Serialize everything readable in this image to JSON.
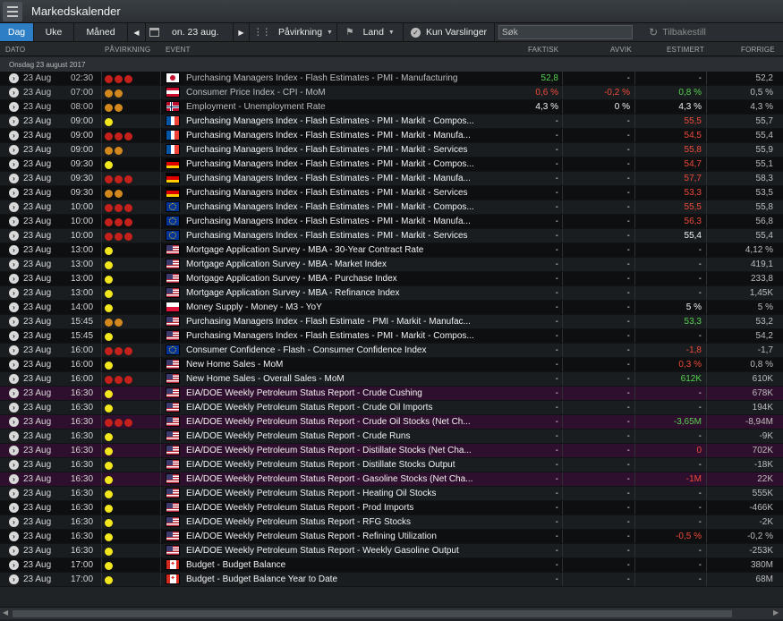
{
  "window": {
    "title": "Markedskalender"
  },
  "toolbar": {
    "day_label": "Dag",
    "week_label": "Uke",
    "month_label": "Måned",
    "date_label": "on. 23 aug.",
    "impact_label": "Påvirkning",
    "country_label": "Land",
    "alerts_label": "Kun Varslinger",
    "search_placeholder": "Søk",
    "reset_label": "Tilbakestill"
  },
  "columns": {
    "date": "DATO",
    "impact": "PÅVIRKNING",
    "event": "EVENT",
    "actual": "FAKTISK",
    "deviation": "AVVIK",
    "estimated": "ESTIMERT",
    "previous": "FORRIGE"
  },
  "group_header": "Onsdag 23 august 2017",
  "colors": {
    "accent": "#2d7ec4",
    "positive": "#55d24e",
    "negative": "#f04a3a",
    "highlight_row": "#2f0f2e"
  },
  "rows": [
    {
      "date": "23 Aug",
      "time": "02:30",
      "impact": "red3",
      "flag": "jp",
      "event": "Purchasing Managers Index - Flash Estimates - PMI - Manufacturing",
      "actual": "52,8",
      "actual_color": "green",
      "dev": "-",
      "dev_color": "",
      "est": "-",
      "est_color": "",
      "prev": "52,2",
      "dim": true
    },
    {
      "date": "23 Aug",
      "time": "07:00",
      "impact": "orange2",
      "flag": "at",
      "event": "Consumer Price Index - CPI - MoM",
      "actual": "0,6 %",
      "actual_color": "red",
      "dev": "-0,2 %",
      "dev_color": "red",
      "est": "0,8 %",
      "est_color": "green",
      "prev": "0,5 %",
      "dim": true
    },
    {
      "date": "23 Aug",
      "time": "08:00",
      "impact": "orange2",
      "flag": "no",
      "event": "Employment - Unemployment Rate",
      "actual": "4,3 %",
      "actual_color": "white",
      "dev": "0 %",
      "dev_color": "white",
      "est": "4,3 %",
      "est_color": "white",
      "prev": "4,3 %",
      "dim": true
    },
    {
      "date": "23 Aug",
      "time": "09:00",
      "impact": "yellow1",
      "flag": "fr",
      "event": "Purchasing Managers Index - Flash Estimates - PMI - Markit - Compos...",
      "actual": "-",
      "actual_color": "",
      "dev": "-",
      "dev_color": "",
      "est": "55,5",
      "est_color": "red",
      "prev": "55,7",
      "dim": false
    },
    {
      "date": "23 Aug",
      "time": "09:00",
      "impact": "red3",
      "flag": "fr",
      "event": "Purchasing Managers Index - Flash Estimates - PMI - Markit - Manufa...",
      "actual": "-",
      "actual_color": "",
      "dev": "-",
      "dev_color": "",
      "est": "54,5",
      "est_color": "red",
      "prev": "55,4",
      "dim": false
    },
    {
      "date": "23 Aug",
      "time": "09:00",
      "impact": "orange2",
      "flag": "fr",
      "event": "Purchasing Managers Index - Flash Estimates - PMI - Markit - Services",
      "actual": "-",
      "actual_color": "",
      "dev": "-",
      "dev_color": "",
      "est": "55,8",
      "est_color": "red",
      "prev": "55,9",
      "dim": false
    },
    {
      "date": "23 Aug",
      "time": "09:30",
      "impact": "yellow1",
      "flag": "de",
      "event": "Purchasing Managers Index - Flash Estimates - PMI - Markit - Compos...",
      "actual": "-",
      "actual_color": "",
      "dev": "-",
      "dev_color": "",
      "est": "54,7",
      "est_color": "red",
      "prev": "55,1",
      "dim": false
    },
    {
      "date": "23 Aug",
      "time": "09:30",
      "impact": "red3",
      "flag": "de",
      "event": "Purchasing Managers Index - Flash Estimates - PMI - Markit - Manufa...",
      "actual": "-",
      "actual_color": "",
      "dev": "-",
      "dev_color": "",
      "est": "57,7",
      "est_color": "red",
      "prev": "58,3",
      "dim": false
    },
    {
      "date": "23 Aug",
      "time": "09:30",
      "impact": "orange2",
      "flag": "de",
      "event": "Purchasing Managers Index - Flash Estimates - PMI - Markit - Services",
      "actual": "-",
      "actual_color": "",
      "dev": "-",
      "dev_color": "",
      "est": "53,3",
      "est_color": "red",
      "prev": "53,5",
      "dim": false
    },
    {
      "date": "23 Aug",
      "time": "10:00",
      "impact": "red3",
      "flag": "eu",
      "event": "Purchasing Managers Index - Flash Estimates - PMI - Markit - Compos...",
      "actual": "-",
      "actual_color": "",
      "dev": "-",
      "dev_color": "",
      "est": "55,5",
      "est_color": "red",
      "prev": "55,8",
      "dim": false
    },
    {
      "date": "23 Aug",
      "time": "10:00",
      "impact": "red3",
      "flag": "eu",
      "event": "Purchasing Managers Index - Flash Estimates - PMI - Markit - Manufa...",
      "actual": "-",
      "actual_color": "",
      "dev": "-",
      "dev_color": "",
      "est": "56,3",
      "est_color": "red",
      "prev": "56,8",
      "dim": false
    },
    {
      "date": "23 Aug",
      "time": "10:00",
      "impact": "red3",
      "flag": "eu",
      "event": "Purchasing Managers Index - Flash Estimates - PMI - Markit - Services",
      "actual": "-",
      "actual_color": "",
      "dev": "-",
      "dev_color": "",
      "est": "55,4",
      "est_color": "white",
      "prev": "55,4",
      "dim": false
    },
    {
      "date": "23 Aug",
      "time": "13:00",
      "impact": "yellow1",
      "flag": "us",
      "event": "Mortgage Application Survey - MBA - 30-Year Contract Rate",
      "actual": "-",
      "actual_color": "",
      "dev": "-",
      "dev_color": "",
      "est": "-",
      "est_color": "",
      "prev": "4,12 %",
      "dim": false
    },
    {
      "date": "23 Aug",
      "time": "13:00",
      "impact": "yellow1",
      "flag": "us",
      "event": "Mortgage Application Survey - MBA - Market Index",
      "actual": "-",
      "actual_color": "",
      "dev": "-",
      "dev_color": "",
      "est": "-",
      "est_color": "",
      "prev": "419,1",
      "dim": false
    },
    {
      "date": "23 Aug",
      "time": "13:00",
      "impact": "yellow1",
      "flag": "us",
      "event": "Mortgage Application Survey - MBA - Purchase Index",
      "actual": "-",
      "actual_color": "",
      "dev": "-",
      "dev_color": "",
      "est": "-",
      "est_color": "",
      "prev": "233,8",
      "dim": false
    },
    {
      "date": "23 Aug",
      "time": "13:00",
      "impact": "yellow1",
      "flag": "us",
      "event": "Mortgage Application Survey - MBA - Refinance Index",
      "actual": "-",
      "actual_color": "",
      "dev": "-",
      "dev_color": "",
      "est": "-",
      "est_color": "",
      "prev": "1,45K",
      "dim": false
    },
    {
      "date": "23 Aug",
      "time": "14:00",
      "impact": "yellow1",
      "flag": "pl",
      "event": "Money Supply - Money - M3 - YoY",
      "actual": "-",
      "actual_color": "",
      "dev": "-",
      "dev_color": "",
      "est": "5 %",
      "est_color": "white",
      "prev": "5 %",
      "dim": false
    },
    {
      "date": "23 Aug",
      "time": "15:45",
      "impact": "orange2",
      "flag": "us",
      "event": "Purchasing Managers Index - Flash Estimate - PMI - Markit - Manufac...",
      "actual": "-",
      "actual_color": "",
      "dev": "-",
      "dev_color": "",
      "est": "53,3",
      "est_color": "green",
      "prev": "53,2",
      "dim": false
    },
    {
      "date": "23 Aug",
      "time": "15:45",
      "impact": "yellow1",
      "flag": "us",
      "event": "Purchasing Managers Index - Flash Estimates - PMI - Markit - Compos...",
      "actual": "-",
      "actual_color": "",
      "dev": "-",
      "dev_color": "",
      "est": "-",
      "est_color": "",
      "prev": "54,2",
      "dim": false
    },
    {
      "date": "23 Aug",
      "time": "16:00",
      "impact": "red3",
      "flag": "eu",
      "event": "Consumer Confidence - Flash - Consumer Confidence Index",
      "actual": "-",
      "actual_color": "",
      "dev": "-",
      "dev_color": "",
      "est": "-1,8",
      "est_color": "red",
      "prev": "-1,7",
      "dim": false
    },
    {
      "date": "23 Aug",
      "time": "16:00",
      "impact": "yellow1",
      "flag": "us",
      "event": "New Home Sales - MoM",
      "actual": "-",
      "actual_color": "",
      "dev": "-",
      "dev_color": "",
      "est": "0,3 %",
      "est_color": "red",
      "prev": "0,8 %",
      "dim": false
    },
    {
      "date": "23 Aug",
      "time": "16:00",
      "impact": "red3",
      "flag": "us",
      "event": "New Home Sales - Overall Sales - MoM",
      "actual": "-",
      "actual_color": "",
      "dev": "-",
      "dev_color": "",
      "est": "612K",
      "est_color": "green",
      "prev": "610K",
      "dim": false
    },
    {
      "date": "23 Aug",
      "time": "16:30",
      "impact": "yellow1",
      "flag": "us",
      "event": "EIA/DOE Weekly Petroleum Status Report - Crude Cushing",
      "actual": "-",
      "actual_color": "",
      "dev": "-",
      "dev_color": "",
      "est": "-",
      "est_color": "",
      "prev": "678K",
      "dim": false,
      "hl": true
    },
    {
      "date": "23 Aug",
      "time": "16:30",
      "impact": "yellow1",
      "flag": "us",
      "event": "EIA/DOE Weekly Petroleum Status Report - Crude Oil Imports",
      "actual": "-",
      "actual_color": "",
      "dev": "-",
      "dev_color": "",
      "est": "-",
      "est_color": "",
      "prev": "194K",
      "dim": false
    },
    {
      "date": "23 Aug",
      "time": "16:30",
      "impact": "red3",
      "flag": "us",
      "event": "EIA/DOE Weekly Petroleum Status Report - Crude Oil Stocks (Net Ch...",
      "actual": "-",
      "actual_color": "",
      "dev": "-",
      "dev_color": "",
      "est": "-3,65M",
      "est_color": "green",
      "prev": "-8,94M",
      "dim": false,
      "hl": true
    },
    {
      "date": "23 Aug",
      "time": "16:30",
      "impact": "yellow1",
      "flag": "us",
      "event": "EIA/DOE Weekly Petroleum Status Report - Crude Runs",
      "actual": "-",
      "actual_color": "",
      "dev": "-",
      "dev_color": "",
      "est": "-",
      "est_color": "",
      "prev": "-9K",
      "dim": false
    },
    {
      "date": "23 Aug",
      "time": "16:30",
      "impact": "yellow1",
      "flag": "us",
      "event": "EIA/DOE Weekly Petroleum Status Report - Distillate Stocks (Net Cha...",
      "actual": "-",
      "actual_color": "",
      "dev": "-",
      "dev_color": "",
      "est": "0",
      "est_color": "red",
      "prev": "702K",
      "dim": false,
      "hl": true
    },
    {
      "date": "23 Aug",
      "time": "16:30",
      "impact": "yellow1",
      "flag": "us",
      "event": "EIA/DOE Weekly Petroleum Status Report - Distillate Stocks Output",
      "actual": "-",
      "actual_color": "",
      "dev": "-",
      "dev_color": "",
      "est": "-",
      "est_color": "",
      "prev": "-18K",
      "dim": false
    },
    {
      "date": "23 Aug",
      "time": "16:30",
      "impact": "yellow1",
      "flag": "us",
      "event": "EIA/DOE Weekly Petroleum Status Report - Gasoline Stocks (Net Cha...",
      "actual": "-",
      "actual_color": "",
      "dev": "-",
      "dev_color": "",
      "est": "-1M",
      "est_color": "red",
      "prev": "22K",
      "dim": false,
      "hl": true
    },
    {
      "date": "23 Aug",
      "time": "16:30",
      "impact": "yellow1",
      "flag": "us",
      "event": "EIA/DOE Weekly Petroleum Status Report - Heating Oil Stocks",
      "actual": "-",
      "actual_color": "",
      "dev": "-",
      "dev_color": "",
      "est": "-",
      "est_color": "",
      "prev": "555K",
      "dim": false
    },
    {
      "date": "23 Aug",
      "time": "16:30",
      "impact": "yellow1",
      "flag": "us",
      "event": "EIA/DOE Weekly Petroleum Status Report - Prod Imports",
      "actual": "-",
      "actual_color": "",
      "dev": "-",
      "dev_color": "",
      "est": "-",
      "est_color": "",
      "prev": "-466K",
      "dim": false
    },
    {
      "date": "23 Aug",
      "time": "16:30",
      "impact": "yellow1",
      "flag": "us",
      "event": "EIA/DOE Weekly Petroleum Status Report - RFG Stocks",
      "actual": "-",
      "actual_color": "",
      "dev": "-",
      "dev_color": "",
      "est": "-",
      "est_color": "",
      "prev": "-2K",
      "dim": false
    },
    {
      "date": "23 Aug",
      "time": "16:30",
      "impact": "yellow1",
      "flag": "us",
      "event": "EIA/DOE Weekly Petroleum Status Report - Refining Utilization",
      "actual": "-",
      "actual_color": "",
      "dev": "-",
      "dev_color": "",
      "est": "-0,5 %",
      "est_color": "red",
      "prev": "-0,2 %",
      "dim": false
    },
    {
      "date": "23 Aug",
      "time": "16:30",
      "impact": "yellow1",
      "flag": "us",
      "event": "EIA/DOE Weekly Petroleum Status Report - Weekly Gasoline Output",
      "actual": "-",
      "actual_color": "",
      "dev": "-",
      "dev_color": "",
      "est": "-",
      "est_color": "",
      "prev": "-253K",
      "dim": false
    },
    {
      "date": "23 Aug",
      "time": "17:00",
      "impact": "yellow1",
      "flag": "ca",
      "event": "Budget - Budget Balance",
      "actual": "-",
      "actual_color": "",
      "dev": "-",
      "dev_color": "",
      "est": "-",
      "est_color": "",
      "prev": "380M",
      "dim": false
    },
    {
      "date": "23 Aug",
      "time": "17:00",
      "impact": "yellow1",
      "flag": "ca",
      "event": "Budget - Budget Balance Year to Date",
      "actual": "-",
      "actual_color": "",
      "dev": "-",
      "dev_color": "",
      "est": "-",
      "est_color": "",
      "prev": "68M",
      "dim": false
    }
  ]
}
